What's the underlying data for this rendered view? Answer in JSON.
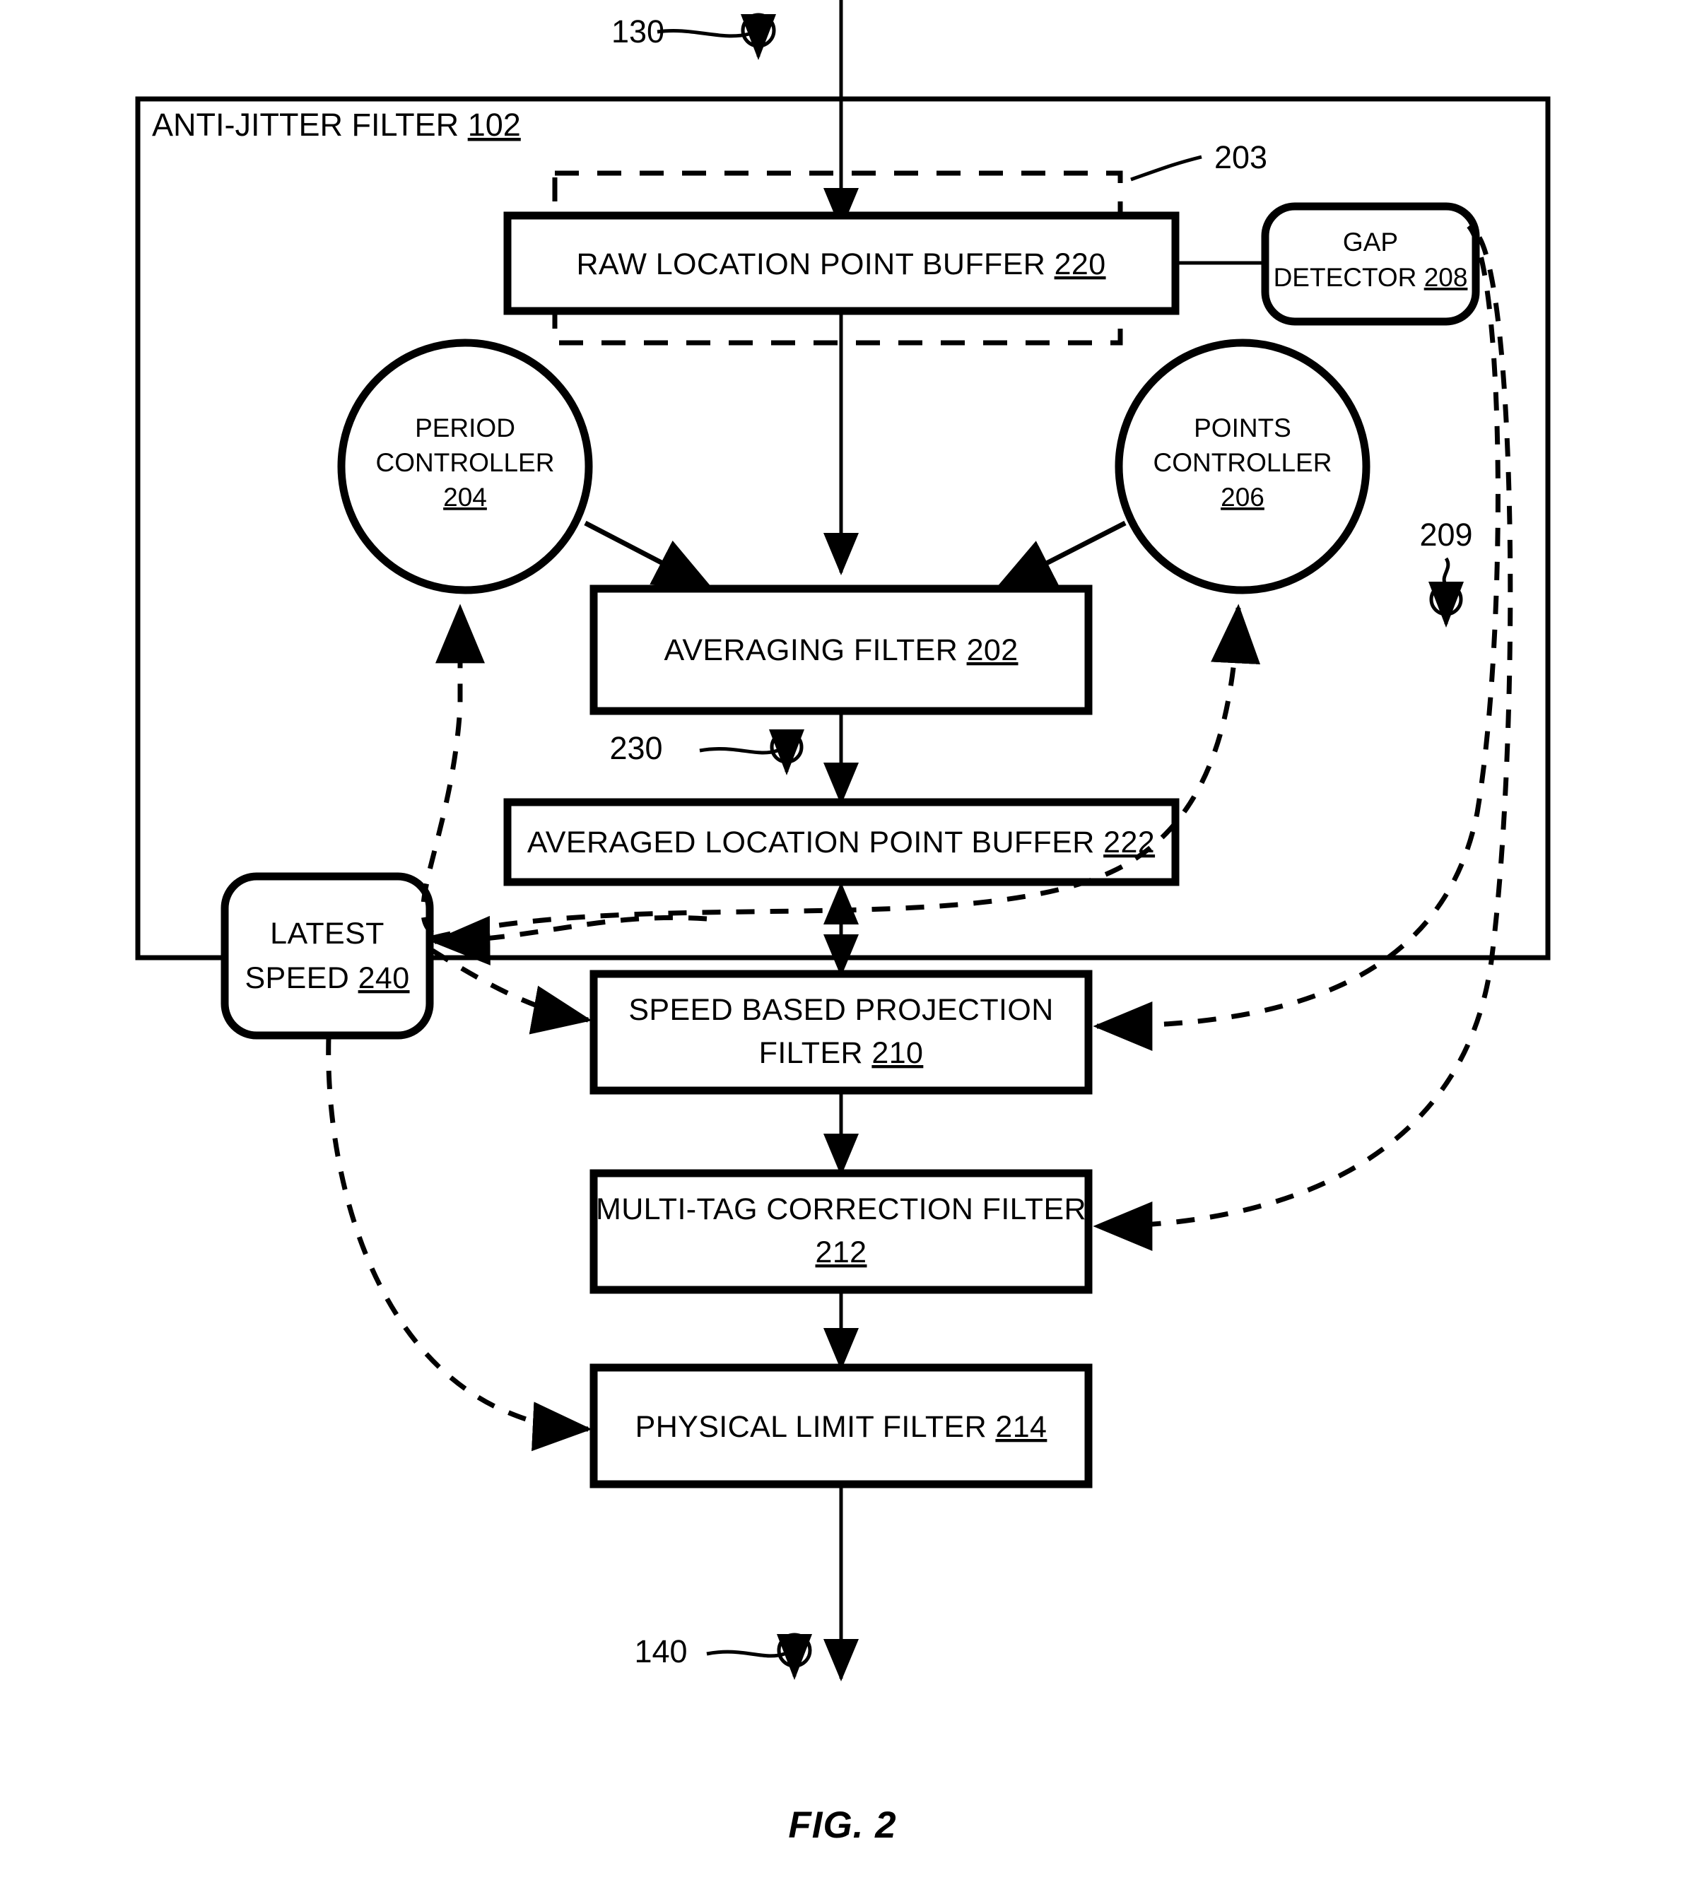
{
  "figure": {
    "caption": "FIG. 2"
  },
  "frame": {
    "title": "ANTI-JITTER FILTER",
    "ref": "102"
  },
  "reference_markers": [
    {
      "name": "input-signal-marker",
      "label": "130"
    },
    {
      "name": "raw-buffer-group-marker",
      "label": "203"
    },
    {
      "name": "gap-feedback-marker",
      "label": "209"
    },
    {
      "name": "averaged-output-marker",
      "label": "230"
    },
    {
      "name": "output-signal-marker",
      "label": "140"
    }
  ],
  "nodes": {
    "raw_buffer": {
      "label": "RAW LOCATION POINT BUFFER",
      "ref": "220"
    },
    "gap_detector": {
      "line1": "GAP",
      "line2": "DETECTOR",
      "ref": "208"
    },
    "period_controller": {
      "line1": "PERIOD",
      "line2": "CONTROLLER",
      "ref": "204"
    },
    "points_controller": {
      "line1": "POINTS",
      "line2": "CONTROLLER",
      "ref": "206"
    },
    "averaging_filter": {
      "label": "AVERAGING FILTER",
      "ref": "202"
    },
    "averaged_buffer": {
      "label": "AVERAGED LOCATION POINT BUFFER",
      "ref": "222"
    },
    "latest_speed": {
      "line1": "LATEST",
      "line2": "SPEED",
      "ref": "240"
    },
    "speed_projection_filter": {
      "line1": "SPEED BASED PROJECTION",
      "line2": "FILTER",
      "ref": "210"
    },
    "multitag_correction_filter": {
      "line1": "MULTI-TAG CORRECTION FILTER",
      "ref": "212"
    },
    "physical_limit_filter": {
      "label": "PHYSICAL LIMIT FILTER",
      "ref": "214"
    }
  },
  "colors": {
    "ink": "#000000",
    "paper": "#ffffff"
  }
}
